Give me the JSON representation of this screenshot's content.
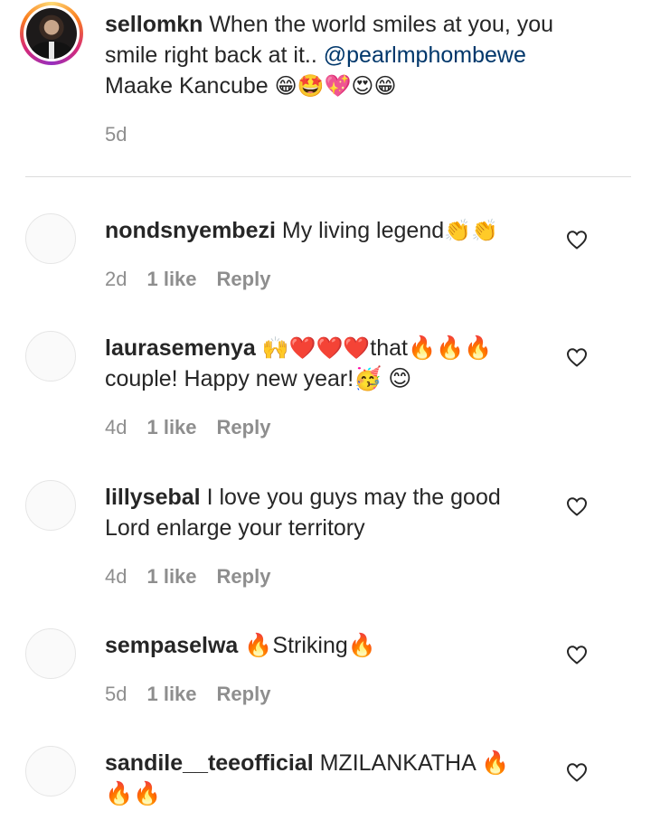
{
  "caption": {
    "username": "sellomkn",
    "text": "When the world smiles at you, you smile right back at it..",
    "mention": "@pearlmphombewe",
    "text_after": "Maake Kancube",
    "emojis": "😁🤩💖😍😁",
    "time": "5d"
  },
  "comments": [
    {
      "username": "nondsnyembezi",
      "text": "My living legend",
      "emojis": "👏👏",
      "time": "2d",
      "likes": "1 like",
      "reply": "Reply"
    },
    {
      "username": "laurasemenya",
      "text_pre": "🙌❤️❤️❤️",
      "text": "that🔥🔥🔥 couple! Happy new year!🥳 😊",
      "time": "4d",
      "likes": "1 like",
      "reply": "Reply"
    },
    {
      "username": "lillysebal",
      "text": "I love you guys may the good Lord enlarge your territory",
      "time": "4d",
      "likes": "1 like",
      "reply": "Reply"
    },
    {
      "username": "sempaselwa",
      "text": "🔥Striking🔥",
      "time": "5d",
      "likes": "1 like",
      "reply": "Reply"
    },
    {
      "username": "sandile__teeofficial",
      "text": "MZILANKATHA 🔥 🔥🔥"
    }
  ],
  "icons": {
    "heart": "heart-outline-icon"
  }
}
